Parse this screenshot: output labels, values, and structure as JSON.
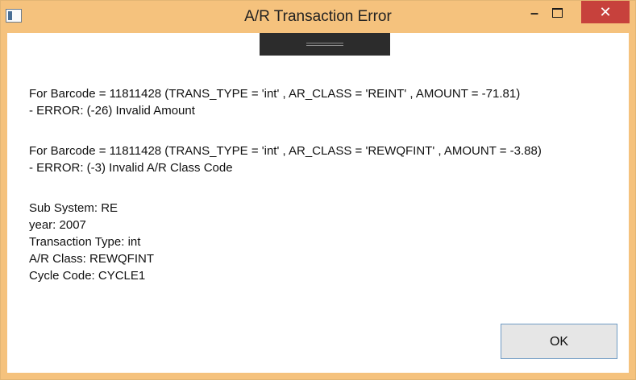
{
  "window": {
    "title": "A/R Transaction Error",
    "controls": {
      "minimize": "–",
      "close": "✕"
    }
  },
  "errors": [
    {
      "line": "For Barcode = 11811428 (TRANS_TYPE = 'int' , AR_CLASS = 'REINT' , AMOUNT = -71.81)",
      "detail": " - ERROR: (-26) Invalid Amount"
    },
    {
      "line": "For Barcode = 11811428 (TRANS_TYPE = 'int' , AR_CLASS = 'REWQFINT' , AMOUNT = -3.88)",
      "detail": " - ERROR: (-3) Invalid A/R Class Code"
    }
  ],
  "info": {
    "sub_system": "Sub System: RE",
    "year": "year: 2007",
    "transaction_type": "Transaction Type: int",
    "ar_class": "A/R Class: REWQFINT",
    "cycle_code": "Cycle Code: CYCLE1"
  },
  "buttons": {
    "ok": "OK"
  },
  "colors": {
    "titlebar": "#f5c27d",
    "close_button": "#c7413c",
    "ok_border": "#6f9ac4"
  }
}
